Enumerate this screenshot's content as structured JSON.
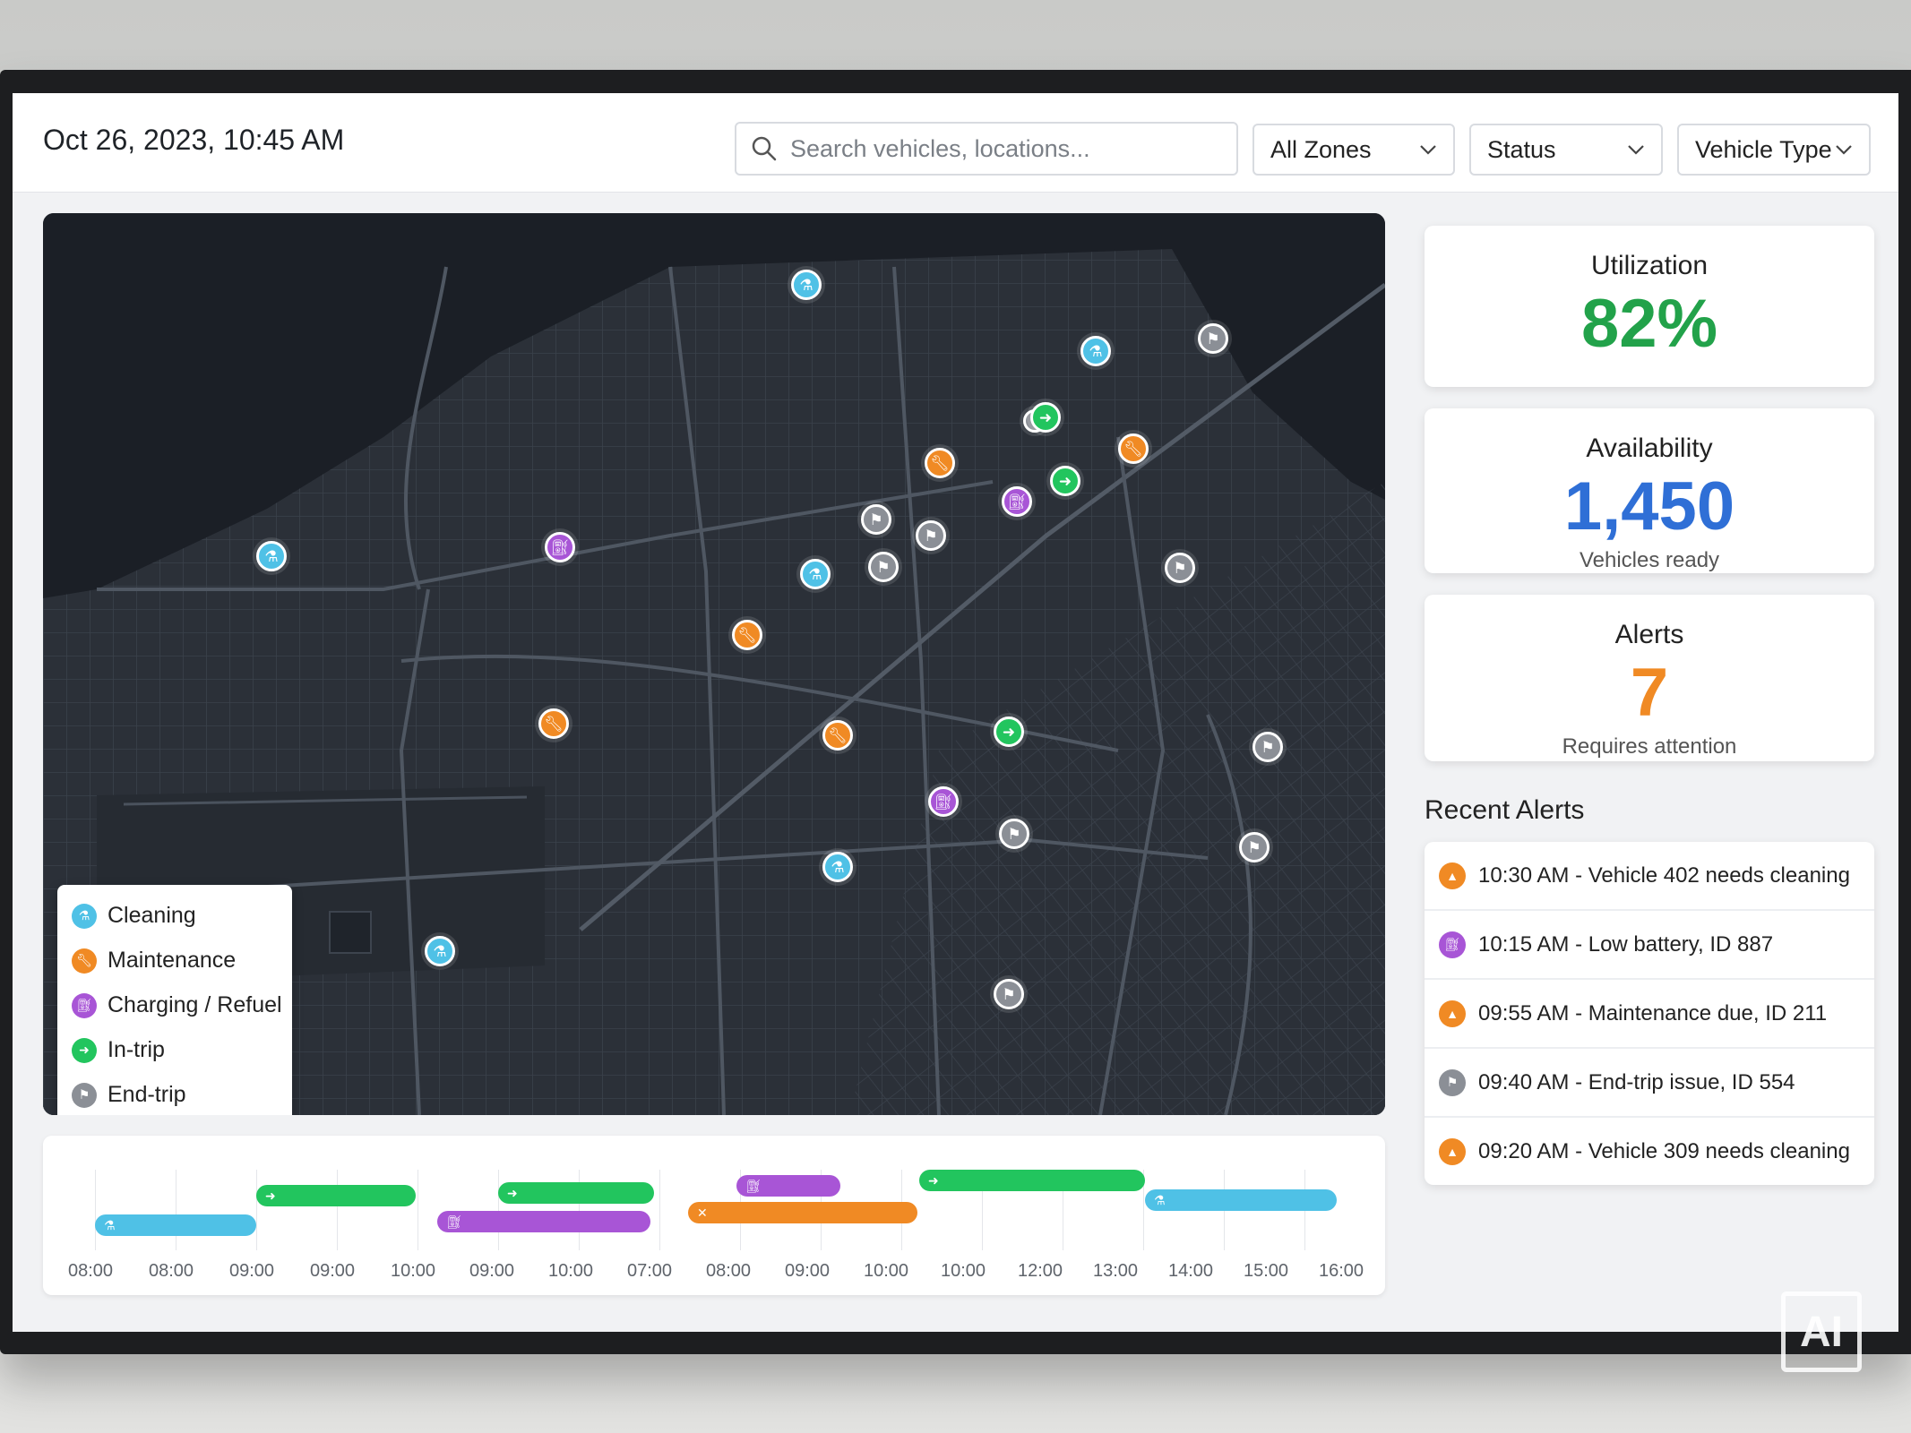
{
  "header": {
    "datetime": "Oct 26, 2023, 10:45 AM",
    "search_placeholder": "Search vehicles, locations...",
    "zones_label": "All Zones",
    "status_label": "Status",
    "vehicle_type_label": "Vehicle Type"
  },
  "legend": {
    "items": [
      {
        "label": "Cleaning",
        "color": "#4fc1e6",
        "icon": "spray-icon"
      },
      {
        "label": "Maintenance",
        "color": "#f08a24",
        "icon": "wrench-icon"
      },
      {
        "label": "Charging / Refuel",
        "color": "#a855d6",
        "icon": "fuel-icon"
      },
      {
        "label": "In-trip",
        "color": "#22c55e",
        "icon": "arrow-right-icon"
      },
      {
        "label": "End-trip",
        "color": "#8b8f96",
        "icon": "flag-icon"
      }
    ]
  },
  "stats": {
    "utilization": {
      "title": "Utilization",
      "value": "82%",
      "color": "#22a24a"
    },
    "availability": {
      "title": "Availability",
      "value": "1,450",
      "sub": "Vehicles ready",
      "color": "#2f6fd6"
    },
    "alerts": {
      "title": "Alerts",
      "value": "7",
      "sub": "Requires attention",
      "color": "#f08a24"
    }
  },
  "recent_alerts": {
    "title": "Recent Alerts",
    "items": [
      {
        "text": "10:30 AM - Vehicle 402 needs cleaning",
        "type": "warning"
      },
      {
        "text": "10:15 AM - Low battery, ID 887",
        "type": "charging"
      },
      {
        "text": "09:55 AM - Maintenance due, ID 211",
        "type": "warning"
      },
      {
        "text": "09:40 AM - End-trip issue, ID 554",
        "type": "end-trip"
      },
      {
        "text": "09:20 AM - Vehicle 309 needs cleaning",
        "type": "warning"
      }
    ]
  },
  "timeline": {
    "ticks": [
      "08:00",
      "08:00",
      "09:00",
      "09:00",
      "10:00",
      "09:00",
      "10:00",
      "07:00",
      "08:00",
      "09:00",
      "10:00",
      "10:00",
      "12:00",
      "13:00",
      "14:00",
      "15:00",
      "16:00"
    ]
  }
}
